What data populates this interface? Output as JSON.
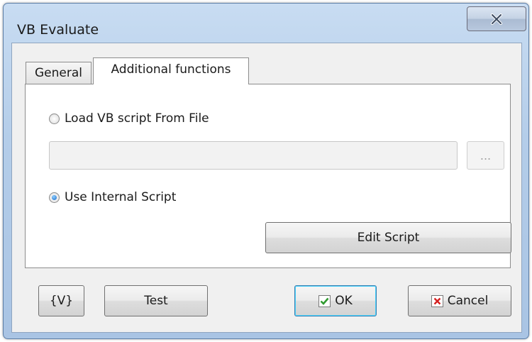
{
  "window": {
    "title": "VB Evaluate"
  },
  "tabs": [
    {
      "label": "General"
    },
    {
      "label": "Additional functions"
    }
  ],
  "panel": {
    "load_file_label": "Load VB script From File",
    "file_path_value": "",
    "browse_label": "...",
    "use_internal_label": "Use Internal Script",
    "edit_script_label": "Edit Script"
  },
  "footer": {
    "variables_label": "{V}",
    "test_label": "Test",
    "ok_label": "OK",
    "cancel_label": "Cancel"
  },
  "colors": {
    "ok_check": "#2f9a2f",
    "cancel_x": "#d42020",
    "title_bar": "#b4cde9"
  },
  "icons": {
    "close": "close-icon",
    "ok": "checkmark-icon",
    "cancel": "x-icon"
  }
}
